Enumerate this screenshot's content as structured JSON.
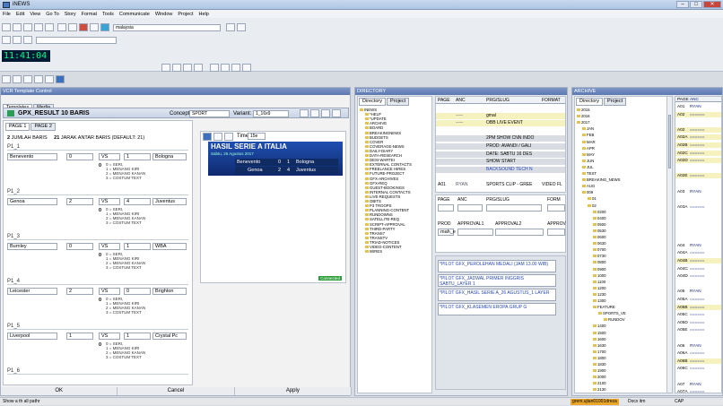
{
  "window": {
    "title": "iNEWS"
  },
  "menu": [
    "File",
    "Edit",
    "View",
    "Go To",
    "Story",
    "Format",
    "Tools",
    "Communicate",
    "Window",
    "Project",
    "Help"
  ],
  "toolbar": {
    "server_combo": "malaysia",
    "clock": "11:41:04"
  },
  "vcr": {
    "title": "VCR Template Control",
    "tabs": [
      "Templates",
      "Media"
    ],
    "template_name": "GPX_RESULT 10 BARIS",
    "concept_label": "Concept:",
    "concept_value": "SPORT",
    "variant_label": "Variant:",
    "variant_value": "1_16x9",
    "page_tabs": [
      "PAGE 1",
      "PAGE 2"
    ],
    "jumlah": {
      "value": "2",
      "label": "JUMLAH BARIS",
      "value2": "21",
      "label2": "JARAK ANTAR BARIS (DEFAULT: 21)"
    },
    "options": [
      "0 = SERI,",
      "1 = MENANG KIRI",
      "2 = MENANG KANAN",
      "3 = COSTUM TEXT"
    ],
    "rows": [
      {
        "section": "P1_1",
        "home": "Benevento",
        "hs": "0",
        "vs": "VS",
        "as": "1",
        "away": "Bologna",
        "flag": "0"
      },
      {
        "section": "P1_2",
        "home": "Genoa",
        "hs": "2",
        "vs": "VS",
        "as": "4",
        "away": "Juventus",
        "flag": "0"
      },
      {
        "section": "P1_3",
        "home": "Burnley",
        "hs": "0",
        "vs": "VS",
        "as": "1",
        "away": "WBA",
        "flag": "0"
      },
      {
        "section": "P1_4",
        "home": "Leicester",
        "hs": "2",
        "vs": "VS",
        "as": "0",
        "away": "Brighton",
        "flag": "0"
      },
      {
        "section": "P1_5",
        "home": "Liverpool",
        "hs": "1",
        "vs": "VS",
        "as": "1",
        "away": "Crystal Pc",
        "flag": "0"
      },
      {
        "section": "P1_6"
      }
    ],
    "preview": {
      "title": "HASIL SERIE A ITALIA",
      "date": "Sabtu, 26 Agustus 2017",
      "scores": [
        {
          "home": "Benevento",
          "hs": "0",
          "as": "1",
          "away": "Bologna"
        },
        {
          "home": "Genoa",
          "hs": "2",
          "as": "4",
          "away": "Juventus"
        }
      ],
      "time_label": "Time",
      "time_value": "15e",
      "status": "Connected"
    },
    "buttons": [
      "OK",
      "Cancel",
      "Apply"
    ]
  },
  "middle": {
    "header": "DIRECTORY",
    "dir_tabs": [
      "Directory",
      "Project"
    ],
    "tree": [
      "INEWS",
      "*HELP",
      "*UPDATE",
      "ARCHIVE",
      "BOARD",
      "BREAKINGNEWS",
      "BUDGETS",
      "COVER",
      "COVERAGE-NEWS",
      "DAILY-DIARY",
      "DATA-RESEARCH",
      "DESI-WARTEI",
      "EXTERNAL CONTACTS",
      "FREELANCE HIRES",
      "FUTURE-PROJECT",
      "GFX-ARCHIVES",
      "GFX-REQ",
      "GUEST-BOOKINGS",
      "INTERNAL CONTACTS",
      "LIVE-REQUESTS",
      "OBITS",
      "P3 TROOPS",
      "PLANNING-CONTENT",
      "RUNDOWNS",
      "SATELLITE-REQ",
      "SCRIPT-APPROVAL",
      "THIRD-PARTY",
      "TRANS7",
      "TRANSTV",
      "TRIAD-NOTICES",
      "VIDEO-CONTENT",
      "WIRES"
    ],
    "rundown_cols": [
      "PAGE",
      "ANC",
      "PRG/SLUG",
      "FORMAT"
    ],
    "rundown_rows": [
      {
        "page": "",
        "anc": "",
        "slug": "",
        "fmt": ""
      },
      {
        "page": "",
        "anc": "-----",
        "slug": "gmal",
        "fmt": ""
      },
      {
        "page": "",
        "anc": "-----",
        "slug": "OBB LIVE EVENT",
        "fmt": ""
      },
      {
        "page": "",
        "anc": "",
        "slug": "",
        "fmt": ""
      },
      {
        "page": "",
        "anc": "",
        "slug": "2PM SHOW CNN INDO",
        "fmt": ""
      },
      {
        "page": "",
        "anc": "",
        "slug": "PROD: AVANDI / GALI",
        "fmt": ""
      },
      {
        "page": "",
        "anc": "",
        "slug": "DATE: SABTU 16 DES",
        "fmt": ""
      },
      {
        "page": "",
        "anc": "",
        "slug": "SHOW START",
        "fmt": ""
      },
      {
        "page": "",
        "anc": "",
        "slug": "BACKSOUND TECH N",
        "fmt": ""
      },
      {
        "page": "",
        "anc": "",
        "slug": "",
        "fmt": ""
      },
      {
        "page": "A01",
        "anc": "RYAN",
        "slug": "SPORTS CLIP - GREE",
        "fmt": "VIDEO FL"
      }
    ],
    "editor_cols": [
      "PAGE",
      "ANC",
      "PRG/SLUG",
      "FORM"
    ],
    "editor_cols2": [
      "PROD",
      "APPROVAL1",
      "APPROVAL2",
      "APPROV"
    ],
    "editor_prod": "mah_e",
    "gfx_items": [
      "*PILOT GFX_PEROLEHAN MEDALI (JAM 13.00 WIB)",
      "*PILOT GFX_JADWAL PRIMER INGGRIS SABTU_LAYER 1",
      "*PILOT GFX_HASIL SERIE A_26 AGUSTUS_1 LAYER",
      "*PILOT GFX_KLASEMEN EROPA GRUP G"
    ]
  },
  "right": {
    "header": "ARCHIVE",
    "dir_tabs": [
      "Directory",
      "Project"
    ],
    "tree": [
      "2015",
      "2016",
      "2017",
      "JAN",
      "FEB",
      "MAR",
      "APR",
      "MAY",
      "JUN",
      "JUL",
      "TEST",
      "BREAKING_NEWS",
      "AUG",
      "009",
      "01",
      "02",
      "0200",
      "0400",
      "0500",
      "0530",
      "0600",
      "0630",
      "0700",
      "0730",
      "0800",
      "0900",
      "1000",
      "1100",
      "1200",
      "1230",
      "1300",
      "FEATURE",
      "SPORTS_VE",
      "RUNDOV",
      "1400",
      "1500",
      "1600",
      "1630",
      "1700",
      "1800",
      "1830",
      "1900",
      "2000",
      "2100",
      "2130"
    ],
    "cols": [
      "PAGE",
      "ANC"
    ],
    "rows": [
      {
        "p": "A01",
        "a": "RYAN"
      },
      {
        "p": "A02",
        "a": "======"
      },
      {
        "p": "",
        "a": ""
      },
      {
        "p": "A02",
        "a": "======"
      },
      {
        "p": "A02A",
        "a": "======"
      },
      {
        "p": "A02B",
        "a": "======"
      },
      {
        "p": "A02C",
        "a": "======"
      },
      {
        "p": "A02D",
        "a": "======"
      },
      {
        "p": "",
        "a": ""
      },
      {
        "p": "A02E",
        "a": "======"
      },
      {
        "p": "",
        "a": ""
      },
      {
        "p": "A03",
        "a": "RYAN"
      },
      {
        "p": "",
        "a": ""
      },
      {
        "p": "A03A",
        "a": "======"
      },
      {
        "p": "",
        "a": ""
      },
      {
        "p": "",
        "a": ""
      },
      {
        "p": "",
        "a": ""
      },
      {
        "p": "",
        "a": ""
      },
      {
        "p": "A04",
        "a": "RYAN"
      },
      {
        "p": "A04A",
        "a": "======"
      },
      {
        "p": "A04B",
        "a": "======"
      },
      {
        "p": "A04C",
        "a": "======"
      },
      {
        "p": "A04D",
        "a": "======"
      },
      {
        "p": "",
        "a": ""
      },
      {
        "p": "A05",
        "a": "RYAN"
      },
      {
        "p": "A05A",
        "a": "======"
      },
      {
        "p": "A05B",
        "a": "======"
      },
      {
        "p": "A05C",
        "a": "======"
      },
      {
        "p": "A05D",
        "a": "======"
      },
      {
        "p": "A05E",
        "a": "======"
      },
      {
        "p": "",
        "a": ""
      },
      {
        "p": "A06",
        "a": "RYAN"
      },
      {
        "p": "A06A",
        "a": "======"
      },
      {
        "p": "A06B",
        "a": "======"
      },
      {
        "p": "A06C",
        "a": "======"
      },
      {
        "p": "",
        "a": ""
      },
      {
        "p": "A07",
        "a": "RYAN"
      },
      {
        "p": "A07A",
        "a": "======"
      }
    ]
  },
  "status": {
    "left": "Show a th all pathr",
    "right_badge": "grem.ujian01001dreza",
    "right_text": "Docx itm",
    "cap": "CAP"
  }
}
